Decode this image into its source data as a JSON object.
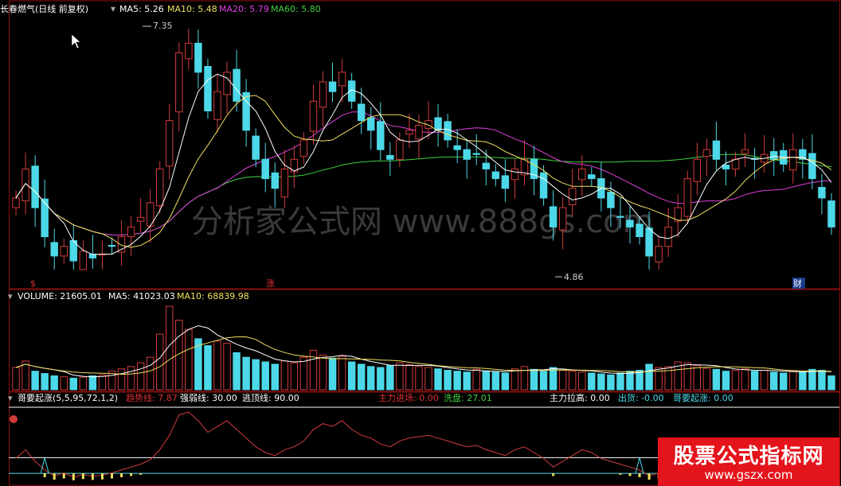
{
  "header": {
    "stock_title": "长春燃气(日线 前复权)",
    "ma5": "MA5: 5.26",
    "ma10": "MA10: 5.48",
    "ma20": "MA20: 5.79",
    "ma60": "MA60: 5.80"
  },
  "price_marks": {
    "high": "7.35",
    "low": "4.86"
  },
  "event_marks": [
    "$",
    "涨",
    "财"
  ],
  "volume_header": {
    "volume": "VOLUME: 21605.01",
    "ma5": "MA5: 41023.03",
    "ma10": "MA10: 68839.98"
  },
  "indicator_header": {
    "name": "哥要起涨(5,5,95,72,1,2)",
    "trend": "趋势线: 7.87",
    "strength": "强弱线: 30.00",
    "escape": "逃顶线: 90.00",
    "main_in": "主力进场: 0.00",
    "wash": "洗盘: 27.01",
    "pull": "主力拉高: 0.00",
    "ship": "出货: -0.00",
    "rise": "哥要起涨: 0.00"
  },
  "watermark": {
    "title": "股票公式指标网",
    "url": "www.gszx.com"
  },
  "bg_watermark": "分析家公式网  www.888gs.com",
  "colors": {
    "up": "#d23c3c",
    "down": "#4cd8e8",
    "ma5": "#ffffff",
    "ma10": "#f0e060",
    "ma20": "#e040e0",
    "ma60": "#40d040",
    "grid": "#8b1010"
  },
  "chart_data": {
    "type": "candlestick",
    "y_max": 7.35,
    "y_min": 4.86,
    "close": [
      5.6,
      5.9,
      5.5,
      5.2,
      5.0,
      5.1,
      4.95,
      5.05,
      4.98,
      5.02,
      5.1,
      5.2,
      5.3,
      5.4,
      5.55,
      5.9,
      6.4,
      7.1,
      7.2,
      6.9,
      6.5,
      6.7,
      6.9,
      6.6,
      6.3,
      6.0,
      5.8,
      5.7,
      5.9,
      6.0,
      6.2,
      6.6,
      6.8,
      6.7,
      6.9,
      6.6,
      6.4,
      6.3,
      6.1,
      6.0,
      6.2,
      6.3,
      6.35,
      6.4,
      6.3,
      6.2,
      6.1,
      6.0,
      6.05,
      5.9,
      5.8,
      5.7,
      5.9,
      6.0,
      5.8,
      5.6,
      5.3,
      5.5,
      5.7,
      5.9,
      5.8,
      5.6,
      5.5,
      5.4,
      5.3,
      5.2,
      5.0,
      5.1,
      5.3,
      5.5,
      5.8,
      6.0,
      6.1,
      6.0,
      5.9,
      6.0,
      6.1,
      6.0,
      6.05,
      6.0,
      5.95,
      6.1,
      6.0,
      5.8,
      5.6,
      5.3
    ],
    "volume": [
      48,
      62,
      40,
      35,
      30,
      28,
      25,
      27,
      30,
      32,
      40,
      45,
      50,
      58,
      70,
      120,
      180,
      150,
      130,
      110,
      95,
      105,
      100,
      80,
      70,
      65,
      60,
      55,
      62,
      58,
      70,
      85,
      75,
      68,
      72,
      60,
      55,
      50,
      48,
      52,
      58,
      54,
      50,
      48,
      45,
      42,
      40,
      38,
      44,
      40,
      38,
      36,
      45,
      50,
      44,
      40,
      48,
      42,
      40,
      38,
      36,
      34,
      32,
      36,
      40,
      42,
      55,
      48,
      50,
      60,
      58,
      52,
      46,
      44,
      40,
      42,
      45,
      40,
      42,
      38,
      36,
      40,
      38,
      44,
      42,
      30
    ]
  }
}
